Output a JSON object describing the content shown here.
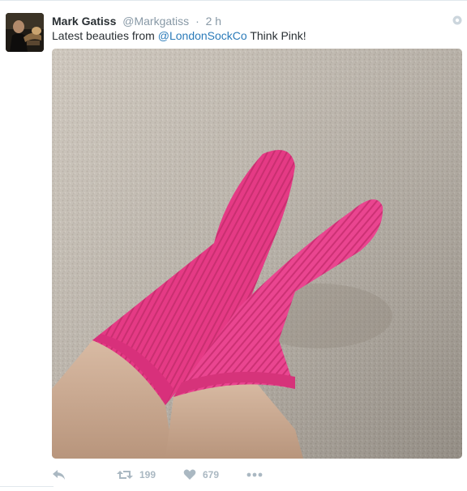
{
  "tweet": {
    "author_name": "Mark Gatiss",
    "handle": "@Markgatiss",
    "separator": "·",
    "time": "2 h",
    "text_before": "Latest beauties from ",
    "mention": "@LondonSockCo",
    "text_after": " Think Pink!"
  },
  "actions": {
    "reply_icon": "reply-icon",
    "retweet_icon": "retweet-icon",
    "retweet_count": "199",
    "like_icon": "heart-icon",
    "like_count": "679",
    "more_icon": "more-dots-icon"
  },
  "colors": {
    "link": "#2b7bb9",
    "meta": "#8899a6",
    "sock_pink": "#e83e86",
    "carpet": "#c9c2b7"
  }
}
